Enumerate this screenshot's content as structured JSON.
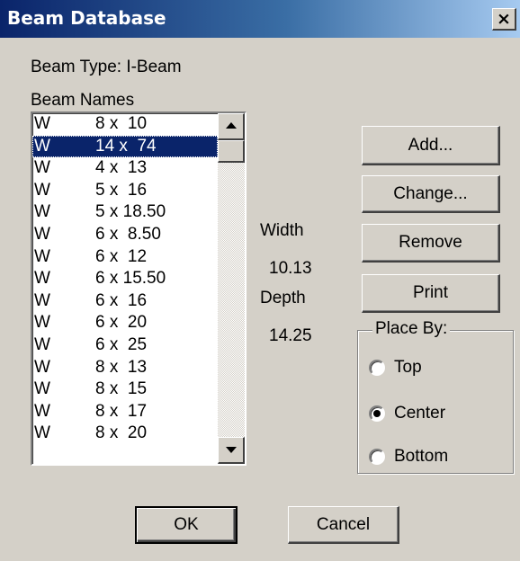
{
  "window": {
    "title": "Beam Database",
    "close_glyph": "×"
  },
  "beam_type_label": "Beam Type: I-Beam",
  "beam_names_label": "Beam Names",
  "beam_list": [
    {
      "type": "W",
      "dims": "8 x  10"
    },
    {
      "type": "W",
      "dims": "14 x  74"
    },
    {
      "type": "W",
      "dims": "4 x  13"
    },
    {
      "type": "W",
      "dims": "5 x  16"
    },
    {
      "type": "W",
      "dims": "5 x 18.50"
    },
    {
      "type": "W",
      "dims": "6 x  8.50"
    },
    {
      "type": "W",
      "dims": "6 x  12"
    },
    {
      "type": "W",
      "dims": "6 x 15.50"
    },
    {
      "type": "W",
      "dims": "6 x  16"
    },
    {
      "type": "W",
      "dims": "6 x  20"
    },
    {
      "type": "W",
      "dims": "6 x  25"
    },
    {
      "type": "W",
      "dims": "8 x  13"
    },
    {
      "type": "W",
      "dims": "8 x  15"
    },
    {
      "type": "W",
      "dims": "8 x  17"
    },
    {
      "type": "W",
      "dims": "8 x  20"
    }
  ],
  "selected_index": 1,
  "width_label": "Width",
  "width_value": "10.13",
  "depth_label": "Depth",
  "depth_value": "14.25",
  "buttons": {
    "add": "Add...",
    "change": "Change...",
    "remove": "Remove",
    "print": "Print",
    "ok": "OK",
    "cancel": "Cancel"
  },
  "place_by": {
    "label": "Place By:",
    "options": [
      "Top",
      "Center",
      "Bottom"
    ],
    "selected": "Center"
  },
  "colors": {
    "title_bar": "#0a246a",
    "selection": "#0a246a",
    "dialog_bg": "#d4d0c8"
  }
}
